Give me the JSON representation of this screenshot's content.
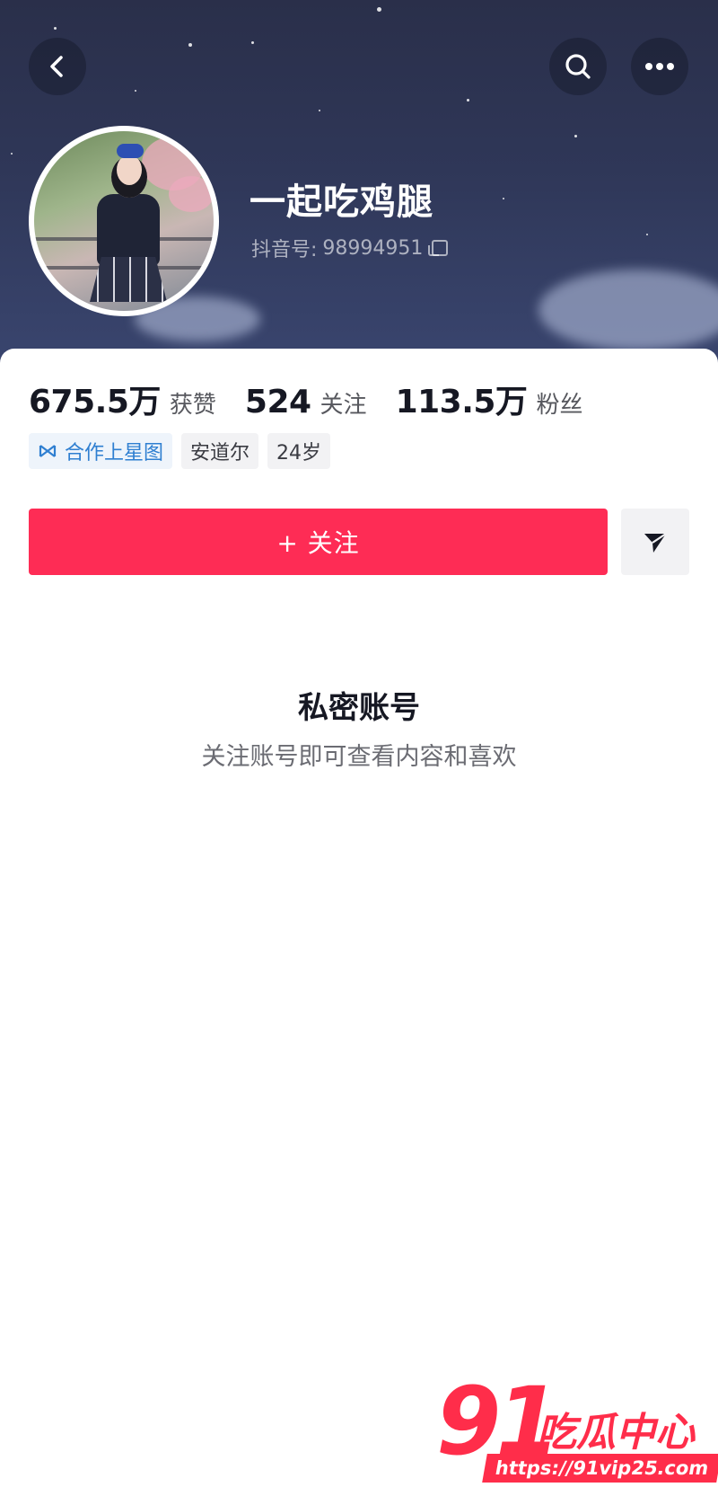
{
  "header": {
    "back_icon": "chevron-left-icon",
    "search_icon": "search-icon",
    "more_icon": "more-dots-icon"
  },
  "profile": {
    "name": "一起吃鸡腿",
    "id_label": "抖音号:",
    "id_value": "98994951",
    "copy_icon": "copy-icon"
  },
  "stats": [
    {
      "value": "675.5万",
      "label": "获赞"
    },
    {
      "value": "524",
      "label": "关注"
    },
    {
      "value": "113.5万",
      "label": "粉丝"
    }
  ],
  "tags": [
    {
      "label": "合作上星图",
      "icon": "star-map-icon",
      "accent": "#2f7fd1"
    },
    {
      "label": "安道尔"
    },
    {
      "label": "24岁"
    }
  ],
  "actions": {
    "follow_label": "+ 关注",
    "share_icon": "send-icon",
    "follow_color": "#fe2c55"
  },
  "private": {
    "title": "私密账号",
    "subtitle": "关注账号即可查看内容和喜欢"
  },
  "watermark": {
    "number": "91",
    "brand": "吃瓜中心",
    "url": "https://91vip25.com",
    "color": "#ff2d4a"
  }
}
